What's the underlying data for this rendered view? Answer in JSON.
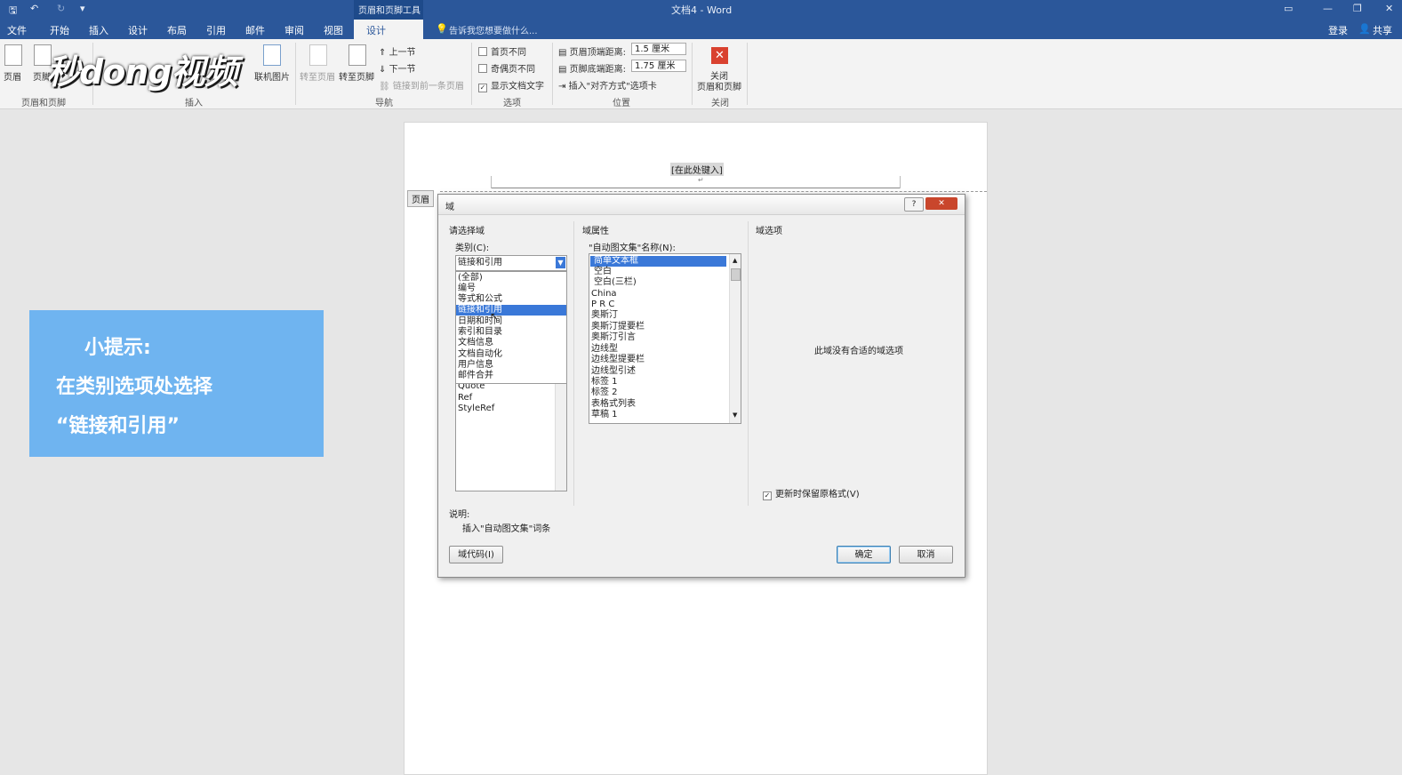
{
  "titlebar": {
    "context_tool": "页眉和页脚工具",
    "doc_title": "文档4 - Word"
  },
  "tabs": [
    "文件",
    "开始",
    "插入",
    "设计",
    "布局",
    "引用",
    "邮件",
    "审阅",
    "视图"
  ],
  "active_tab": "设计",
  "tell_me": "告诉我您想要做什么...",
  "account": {
    "login": "登录",
    "share": "共享"
  },
  "ribbon": {
    "groups": [
      "页眉和页脚",
      "插入",
      "导航",
      "选项",
      "位置",
      "关闭"
    ],
    "items": {
      "header": "页眉",
      "footer": "页脚",
      "online_picture": "联机图片",
      "goto_header": "转至页眉",
      "goto_footer": "转至页脚",
      "prev": "上一节",
      "next": "下一节",
      "link_prev": "链接到前一条页眉",
      "first_page_diff": "首页不同",
      "odd_even_diff": "奇偶页不同",
      "show_doc_text": "显示文档文字",
      "header_top": "页眉顶端距离:",
      "header_top_val": "1.5 厘米",
      "footer_bottom": "页脚底端距离:",
      "footer_bottom_val": "1.75 厘米",
      "insert_align_tab": "插入\"对齐方式\"选项卡",
      "close_line1": "关闭",
      "close_line2": "页眉和页脚"
    }
  },
  "watermark": "秒dong视频",
  "document": {
    "header_placeholder": "[在此处键入]",
    "header_tag": "页眉"
  },
  "hint": {
    "line1": "小提示:",
    "line2": "在类别选项处选择",
    "line3": "“链接和引用”"
  },
  "dialog": {
    "title": "域",
    "left_section": "请选择域",
    "category_label": "类别(C):",
    "category_value": "链接和引用",
    "category_options": [
      "(全部)",
      "编号",
      "等式和公式",
      "链接和引用",
      "日期和时间",
      "索引和目录",
      "文档信息",
      "文档自动化",
      "用户信息",
      "邮件合并"
    ],
    "category_selected_index": 3,
    "field_names_behind": [
      "Quote",
      "Ref",
      "StyleRef"
    ],
    "props_section": "域属性",
    "autotext_label": "\"自动图文集\"名称(N):",
    "autotext_items": [
      "简单文本框",
      "空白",
      "空白(三栏)",
      "China",
      "P R C",
      "奥斯汀",
      "奥斯汀提要栏",
      "奥斯汀引言",
      "边线型",
      "边线型提要栏",
      "边线型引述",
      "标签 1",
      "标签 2",
      "表格式列表",
      "草稿 1"
    ],
    "autotext_selected_index": 0,
    "options_section": "域选项",
    "no_options": "此域没有合适的域选项",
    "preserve_format": "更新时保留原格式(V)",
    "desc_label": "说明:",
    "desc_text": "插入\"自动图文集\"词条",
    "field_codes_btn": "域代码(I)",
    "ok_btn": "确定",
    "cancel_btn": "取消",
    "help": "?",
    "close": "✕"
  }
}
